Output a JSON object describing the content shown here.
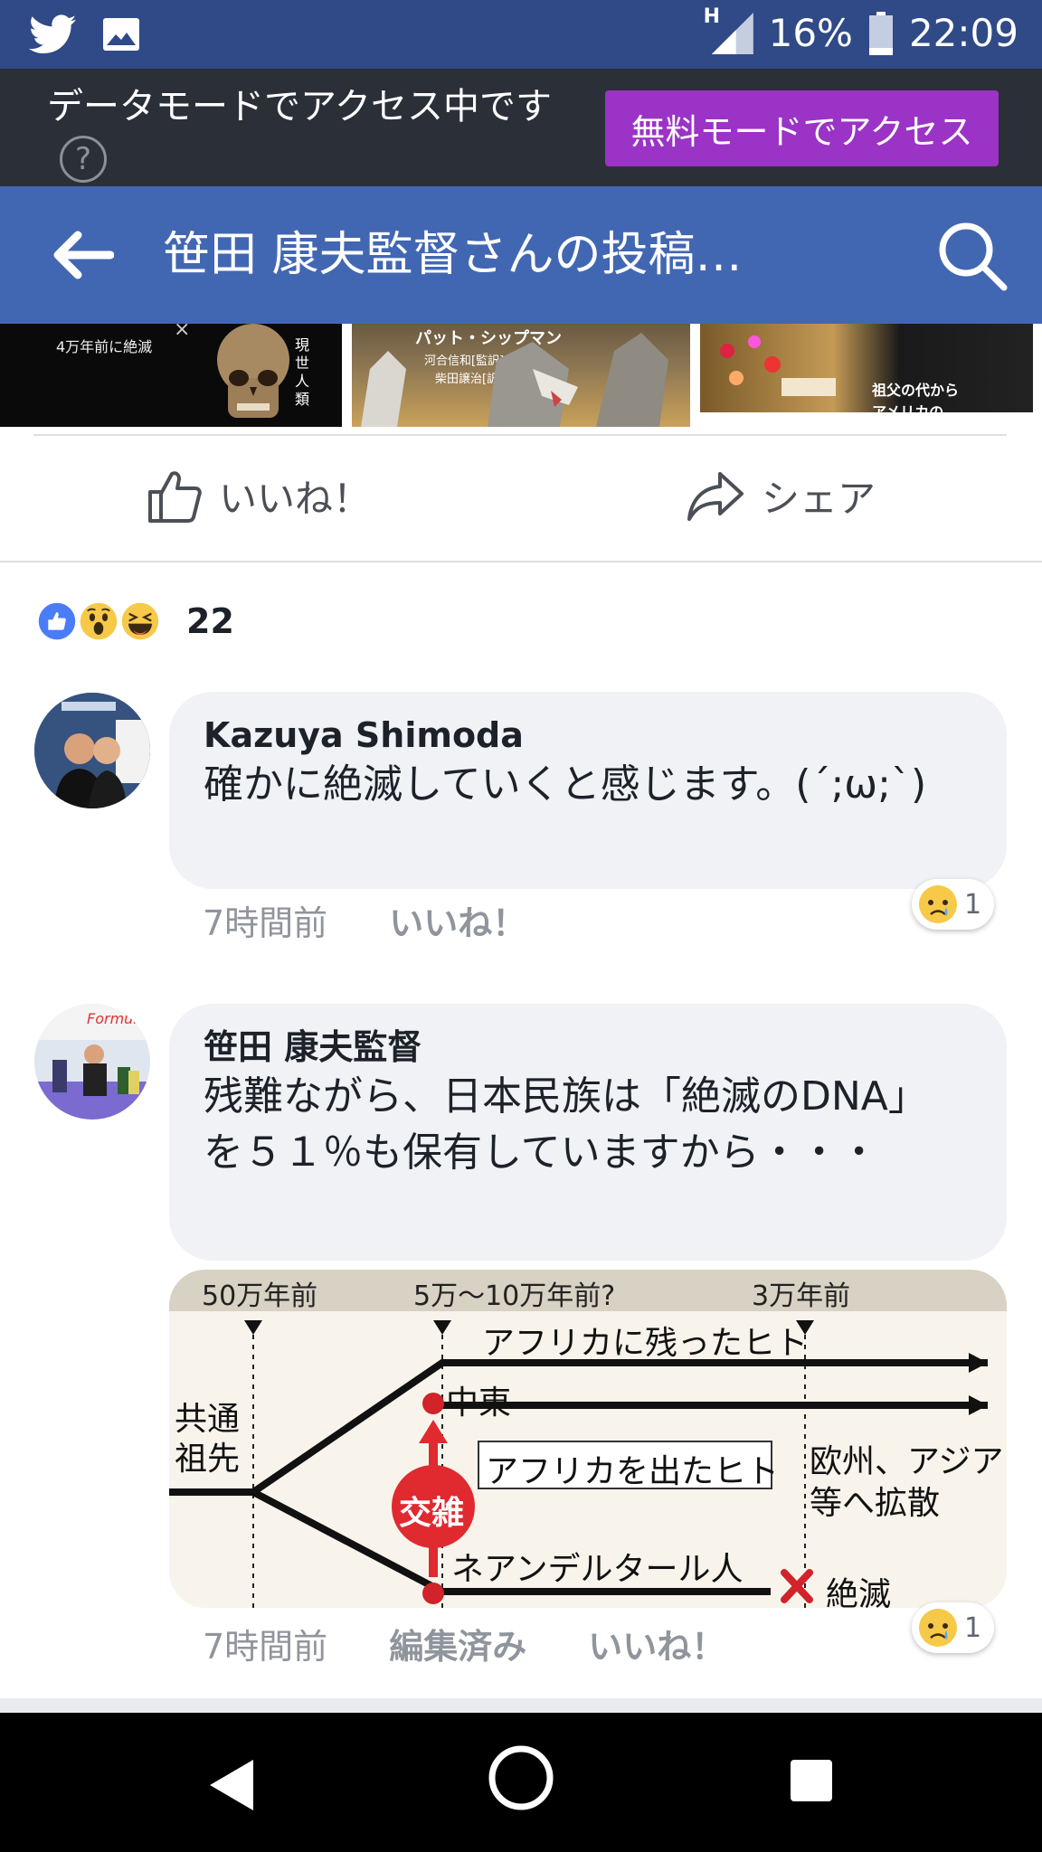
{
  "status_bar": {
    "signal_label": "H",
    "battery": "16%",
    "time": "22:09"
  },
  "data_mode_banner": {
    "message": "データモードでアクセス中です",
    "help": "?",
    "button_label": "無料モードでアクセス"
  },
  "header": {
    "title": "笹田 康夫監督さんの投稿…"
  },
  "image_strip": {
    "thumb1": {
      "caption": "4万年前に絶滅",
      "side_label": "現世人類",
      "close": "×"
    },
    "thumb2": {
      "title": "パット・シップマン",
      "sub1": "河合信和[監訳]",
      "sub2": "柴田譲治[訳]"
    },
    "thumb3": {
      "caption1": "祖父の代から",
      "caption2": "アメリカの"
    }
  },
  "actions": {
    "like_label": "いいね！",
    "share_label": "シェア"
  },
  "reactions": {
    "types": [
      "like",
      "wow",
      "haha"
    ],
    "count": "22"
  },
  "comments": [
    {
      "author": "Kazuya Shimoda",
      "text": "確かに絶滅していくと感じます。(´;ω;`)",
      "time": "7時間前",
      "like_label": "いいね！",
      "reaction_count": "1"
    },
    {
      "author": "笹田 康夫監督",
      "text": "残難ながら、日本民族は「絶滅のDNA」を５１％も保有していますから・・・",
      "time": "7時間前",
      "edited_label": "編集済み",
      "like_label": "いいね！",
      "reaction_count": "1"
    }
  ],
  "diagram": {
    "tick1": "50万年前",
    "tick2": "5万〜10万年前?",
    "tick3": "3万年前",
    "common_ancestor": "共通祖先",
    "stay_africa": "アフリカに残ったヒト",
    "middle_east": "中東",
    "left_africa": "アフリカを出たヒト",
    "spread": "欧州、アジア等へ拡散",
    "interbreed": "交雑",
    "neanderthal": "ネアンデルタール人",
    "extinct": "絶滅",
    "extinct_mark": "✕"
  },
  "colors": {
    "status_bar": "#2f4a86",
    "header": "#4267b2",
    "banner": "#2b2f38",
    "accent_button": "#9b33c6",
    "bubble": "#f0f2f5"
  }
}
